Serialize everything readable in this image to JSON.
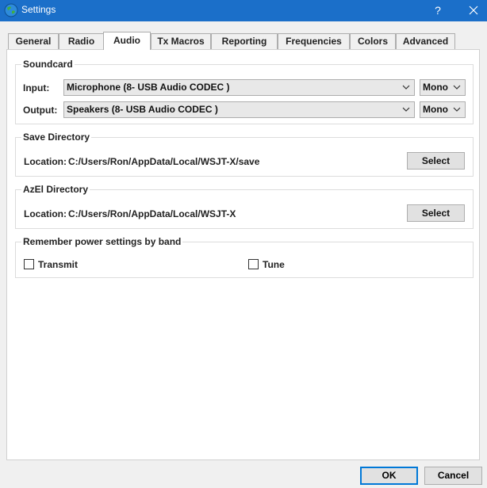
{
  "window": {
    "title": "Settings",
    "help_label": "?",
    "close_label": "✕"
  },
  "tabs": [
    {
      "label": "General"
    },
    {
      "label": "Radio"
    },
    {
      "label": "Audio",
      "active": true
    },
    {
      "label": "Tx Macros"
    },
    {
      "label": "Reporting"
    },
    {
      "label": "Frequencies"
    },
    {
      "label": "Colors"
    },
    {
      "label": "Advanced"
    }
  ],
  "soundcard": {
    "title": "Soundcard",
    "input_label": "Input:",
    "input_value": "Microphone (8- USB Audio CODEC )",
    "input_channel": "Mono",
    "output_label": "Output:",
    "output_value": "Speakers (8- USB Audio CODEC )",
    "output_channel": "Mono"
  },
  "save_directory": {
    "title": "Save Directory",
    "location_label": "Location:",
    "location_value": "C:/Users/Ron/AppData/Local/WSJT-X/save",
    "select_label": "Select"
  },
  "azel_directory": {
    "title": "AzEl Directory",
    "location_label": "Location:",
    "location_value": "C:/Users/Ron/AppData/Local/WSJT-X",
    "select_label": "Select"
  },
  "power_settings": {
    "title": "Remember power settings by band",
    "transmit_label": "Transmit",
    "transmit_checked": false,
    "tune_label": "Tune",
    "tune_checked": false
  },
  "footer": {
    "ok_label": "OK",
    "cancel_label": "Cancel"
  }
}
